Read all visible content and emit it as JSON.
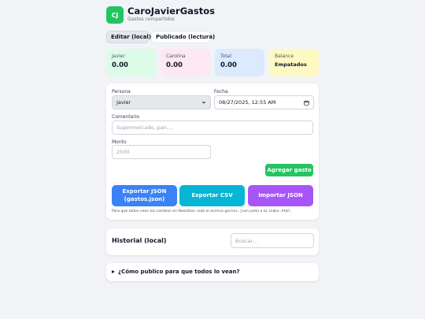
{
  "app": {
    "logo": "CJ",
    "title": "CaroJavierGastos",
    "subtitle": "Gastos compartidos"
  },
  "tabs": {
    "edit": "Editar (local)",
    "published": "Publicado (lectura)"
  },
  "stats": {
    "javier": {
      "label": "Javier",
      "value": "0.00",
      "color": "#dcfce7"
    },
    "carolina": {
      "label": "Carolina",
      "value": "0.00",
      "color": "#fce7f3"
    },
    "total": {
      "label": "Total",
      "value": "0.00",
      "color": "#dbeafe"
    },
    "balance": {
      "label": "Balance",
      "value": "Empatados",
      "color": "#fef9c3"
    }
  },
  "form": {
    "person_label": "Persona",
    "person_value": "Javier",
    "date_label": "Fecha",
    "date_value": "08/27/2025, 12:55 AM",
    "comment_label": "Comentario",
    "comment_placeholder": "Supermercado, pan....",
    "amount_label": "Monto",
    "amount_placeholder": "2500",
    "add_button": "Agregar gasto"
  },
  "actions": {
    "export_json": "Exportar JSON (gastos.json)",
    "export_csv": "Exportar CSV",
    "import_json": "Importar JSON"
  },
  "hint": {
    "before": "Para que todos vean los cambios en Neocities: subí el archivo ",
    "file": "gastos.json",
    "middle": " junto a tu ",
    "page": "index.html",
    "after": "."
  },
  "history": {
    "title": "Historial (local)",
    "search_placeholder": "Buscar..."
  },
  "faq": {
    "question": "¿Cómo publico para que todos lo vean?"
  },
  "colors": {
    "accent_green": "#22c55e",
    "blue": "#3b82f6",
    "cyan": "#06b6d4",
    "purple": "#a855f7"
  }
}
